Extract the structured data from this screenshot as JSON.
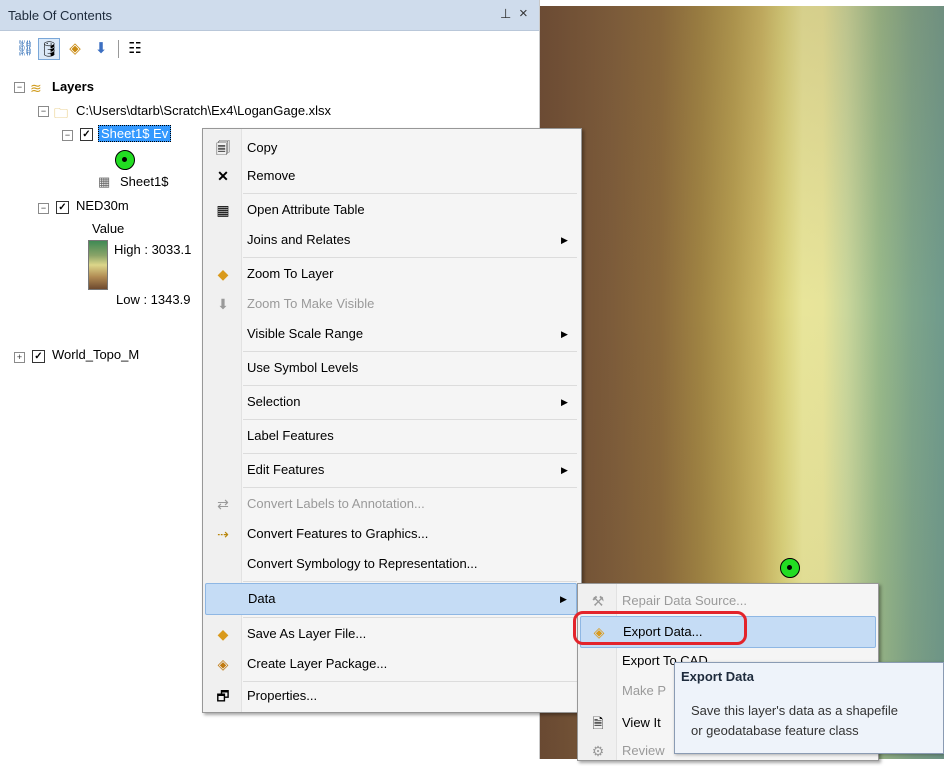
{
  "toc": {
    "title": "Table Of Contents",
    "pin_glyph": "14",
    "pin_label": "ᵠ",
    "close_label": "×",
    "tree": {
      "root": "Layers",
      "source_path": "C:\\Users\\dtarb\\Scratch\\Ex4\\LoganGage.xlsx",
      "events_layer": "Sheet1$ Ev",
      "table": "Sheet1$",
      "ned_layer": "NED30m",
      "value_label": "Value",
      "high_label": "High : 3033.1",
      "low_label": "Low : 1343.9",
      "topo_layer": "World_Topo_M"
    }
  },
  "context_menu": {
    "items": [
      {
        "label": "Copy"
      },
      {
        "label": "Remove"
      },
      {
        "label": "Open Attribute Table"
      },
      {
        "label": "Joins and Relates"
      },
      {
        "label": "Zoom To Layer"
      },
      {
        "label": "Zoom To Make Visible"
      },
      {
        "label": "Visible Scale Range"
      },
      {
        "label": "Use Symbol Levels"
      },
      {
        "label": "Selection"
      },
      {
        "label": "Label Features"
      },
      {
        "label": "Edit Features"
      },
      {
        "label": "Convert Labels to Annotation..."
      },
      {
        "label": "Convert Features to Graphics..."
      },
      {
        "label": "Convert Symbology to Representation..."
      },
      {
        "label": "Data"
      },
      {
        "label": "Save As Layer File..."
      },
      {
        "label": "Create Layer Package..."
      },
      {
        "label": "Properties..."
      }
    ]
  },
  "data_submenu": {
    "items": [
      {
        "label": "Repair Data Source..."
      },
      {
        "label": "Export Data..."
      },
      {
        "label": "Export To CAD"
      },
      {
        "label": "Make P"
      },
      {
        "label": "View It"
      },
      {
        "label": "Review"
      }
    ]
  },
  "tooltip": {
    "title": "Export Data",
    "line1": "Save this layer's data as a shapefile",
    "line2": "or geodatabase feature class"
  },
  "colors": {
    "highlight_ring": "#e3242b",
    "selection_blue": "#3399ff",
    "point_symbol": "#22dd22",
    "ramp_high": "#3f8a54",
    "ramp_low": "#6e4a2e"
  }
}
